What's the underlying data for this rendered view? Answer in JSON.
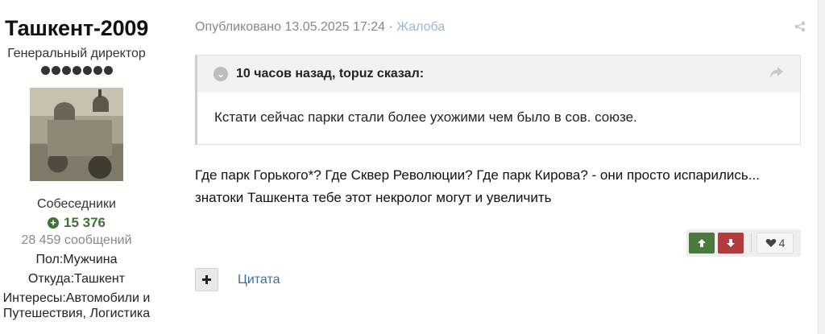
{
  "author": {
    "name": "Ташкент-2009",
    "title": "Генеральный директор",
    "rank_dots": 7,
    "group": "Собеседники",
    "reputation": "15 376",
    "posts": "28 459 сообщений",
    "gender_label": "Пол:",
    "gender": "Мужчина",
    "location_label": "Откуда:",
    "location": "Ташкент",
    "interests_label": "Интересы:",
    "interests_line1": "Автомобили и",
    "interests_line2": "Путешествия, Логистика"
  },
  "post": {
    "published": "Опубликовано 13.05.2025 17:24",
    "separator": "·",
    "report": "Жалоба",
    "quote": {
      "header": "10 часов назад, topuz сказал:",
      "text": "Кстати сейчас парки стали более ухожими чем было в сов. союзе."
    },
    "body_line1": "Где парк Горького*? Где Сквер Революции? Где парк Кирова? - они просто испарились...",
    "body_line2": "знатоки Ташкента тебе этот некролог могут и увеличить",
    "likes": "4",
    "quote_link": "Цитата"
  },
  "icons": {
    "share": "share-icon",
    "quote_toggle": "chevron-down-icon",
    "quote_share": "share-arrow-icon",
    "vote_up": "arrow-up-icon",
    "vote_down": "arrow-down-icon",
    "like": "heart-icon",
    "multiquote": "plus-icon",
    "reputation": "plus-circle-icon"
  },
  "colors": {
    "vote_up": "#4c7a3e",
    "vote_down": "#b33b3b",
    "reputation": "#3e7534",
    "link": "#3d6fa0"
  }
}
